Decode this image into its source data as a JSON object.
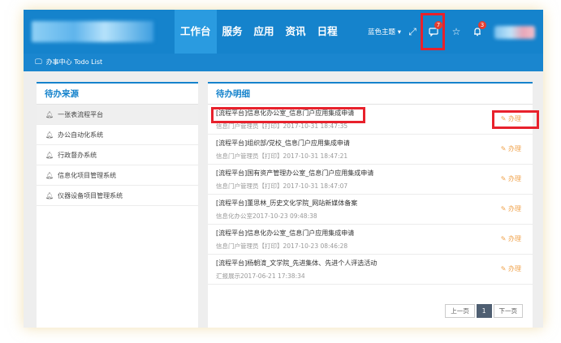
{
  "header": {
    "nav": [
      "工作台",
      "服务",
      "应用",
      "资讯",
      "日程"
    ],
    "theme_label": "蓝色主题 ▾",
    "message_badge": "7",
    "notice_badge": "3"
  },
  "subbar": {
    "title": "办事中心 Todo List"
  },
  "sources": {
    "title": "待办来源",
    "items": [
      "一张表流程平台",
      "办公自动化系统",
      "行政督办系统",
      "信息化项目管理系统",
      "仪器设备项目管理系统"
    ]
  },
  "todos": {
    "title": "待办明细",
    "handle_label": "办理",
    "items": [
      {
        "title": "[流程平台]信息化办公室_信息门户应用集成申请",
        "meta": "信息门户管理员【打印】2017-10-31 18:47:35"
      },
      {
        "title": "[流程平台]组织部/党校_信息门户应用集成申请",
        "meta": "信息门户管理员【打印】2017-10-31 18:47:21"
      },
      {
        "title": "[流程平台]国有资产管理办公室_信息门户应用集成申请",
        "meta": "信息门户管理员【打印】2017-10-31 18:47:07"
      },
      {
        "title": "[流程平台]董思林_历史文化学院_网站新媒体备案",
        "meta": "信息化办公室2017-10-23 09:48:38"
      },
      {
        "title": "[流程平台]信息化办公室_信息门户应用集成申请",
        "meta": "信息门户管理员【打印】2017-10-23 08:46:28"
      },
      {
        "title": "[流程平台]杨朝淯_文学院_先进集体、先进个人评选活动",
        "meta": "汇报展示2017-06-21 17:38:34"
      }
    ]
  },
  "pager": {
    "prev": "上一页",
    "current": "1",
    "next": "下一页"
  }
}
